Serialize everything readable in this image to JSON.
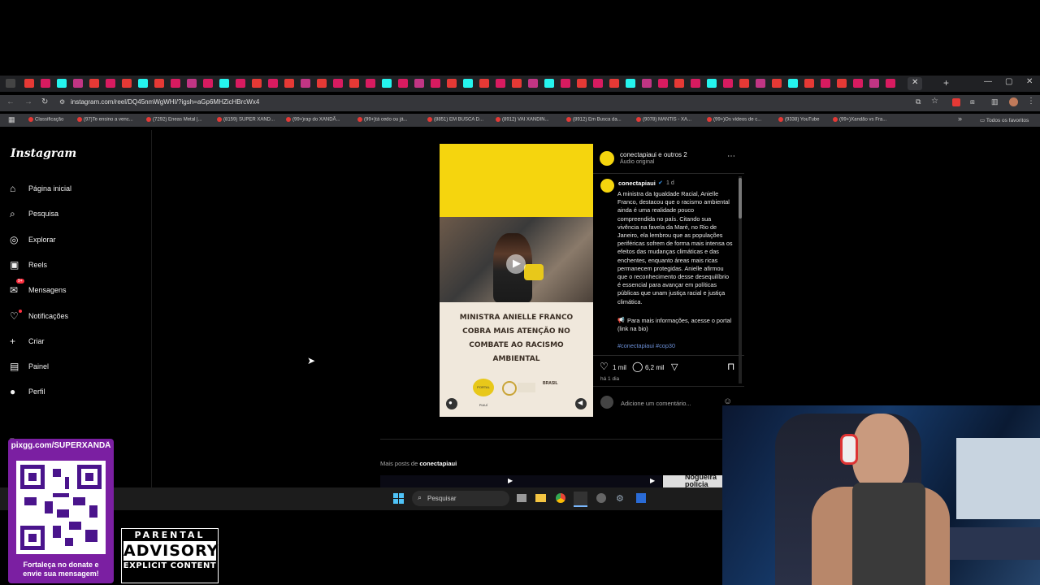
{
  "browser": {
    "url": "instagram.com/reel/DQ45nmWgWHI/?igsh=aGp6MHZicHBrcWx4",
    "all_bookmarks_label": "Todos os favoritos",
    "bookmarks": [
      "Classificação",
      "(97)Te ensino a venc...",
      "(7292) Eneas Metal |...",
      "(8159) SUPER XAND...",
      "(99+)rap do XANDÃ...",
      "(99+)tá cedo ou já...",
      "(8851) EM BUSCA D...",
      "(8912) VAI XANDIN...",
      "(8912) Em Busca da...",
      "(9078) MANTIS - XA...",
      "(99+)Os vídeos de c...",
      "(9338) YouTube",
      "(99+)Xandão vs Fra..."
    ]
  },
  "sidebar": {
    "logo": "Instagram",
    "messages_badge": "9+",
    "items": [
      {
        "label": "Página inicial",
        "icon": "home-icon"
      },
      {
        "label": "Pesquisa",
        "icon": "search-icon"
      },
      {
        "label": "Explorar",
        "icon": "compass-icon"
      },
      {
        "label": "Reels",
        "icon": "reels-icon"
      },
      {
        "label": "Mensagens",
        "icon": "messenger-icon"
      },
      {
        "label": "Notificações",
        "icon": "heart-icon"
      },
      {
        "label": "Criar",
        "icon": "plus-icon"
      },
      {
        "label": "Painel",
        "icon": "chart-icon"
      },
      {
        "label": "Perfil",
        "icon": "avatar-icon"
      }
    ]
  },
  "post": {
    "header_user": "conectapiaui e outros 2",
    "header_audio": "Áudio original",
    "username": "conectapiaui",
    "time_ago": "1 d",
    "caption": "A ministra da Igualdade Racial, Anielle Franco, destacou que o racismo ambiental ainda é uma realidade pouco compreendida no país. Citando sua vivência na favela da Maré, no Rio de Janeiro, ela lembrou que as populações periféricas sofrem de forma mais intensa os efeitos das mudanças climáticas e das enchentes, enquanto áreas mais ricas permanecem protegidas. Anielle afirmou que o reconhecimento desse desequilíbrio é essencial para avançar em políticas públicas que unam justiça racial e justiça climática.",
    "cta": "Para mais informações, acesse o portal (link na bio)",
    "hashtags": "#conectapiaui #cop30",
    "likes": "1 mil",
    "comments": "6,2 mil",
    "posted": "há 1 dia",
    "comment_placeholder": "Adicione um comentário...",
    "media_headline": "MINISTRA ANIELLE FRANCO COBRA MAIS ATENÇÃO NO COMBATE AO RACISMO AMBIENTAL",
    "logos": [
      "PORTAL PIAUÍ",
      "BRASIL"
    ]
  },
  "more_posts": {
    "prefix": "Mais posts de",
    "user": "conectapiaui",
    "thumb_text": "Nogueira policia"
  },
  "taskbar": {
    "search_placeholder": "Pesquisar"
  },
  "overlay": {
    "qr_url": "pixgg.com/SUPERXANDÃ",
    "qr_footer_line1": "Fortaleça no donate e",
    "qr_footer_line2": "envie sua mensagem!",
    "advisory_top": "PARENTAL",
    "advisory_mid": "ADVISORY",
    "advisory_bottom": "EXPLICIT CONTENT"
  }
}
